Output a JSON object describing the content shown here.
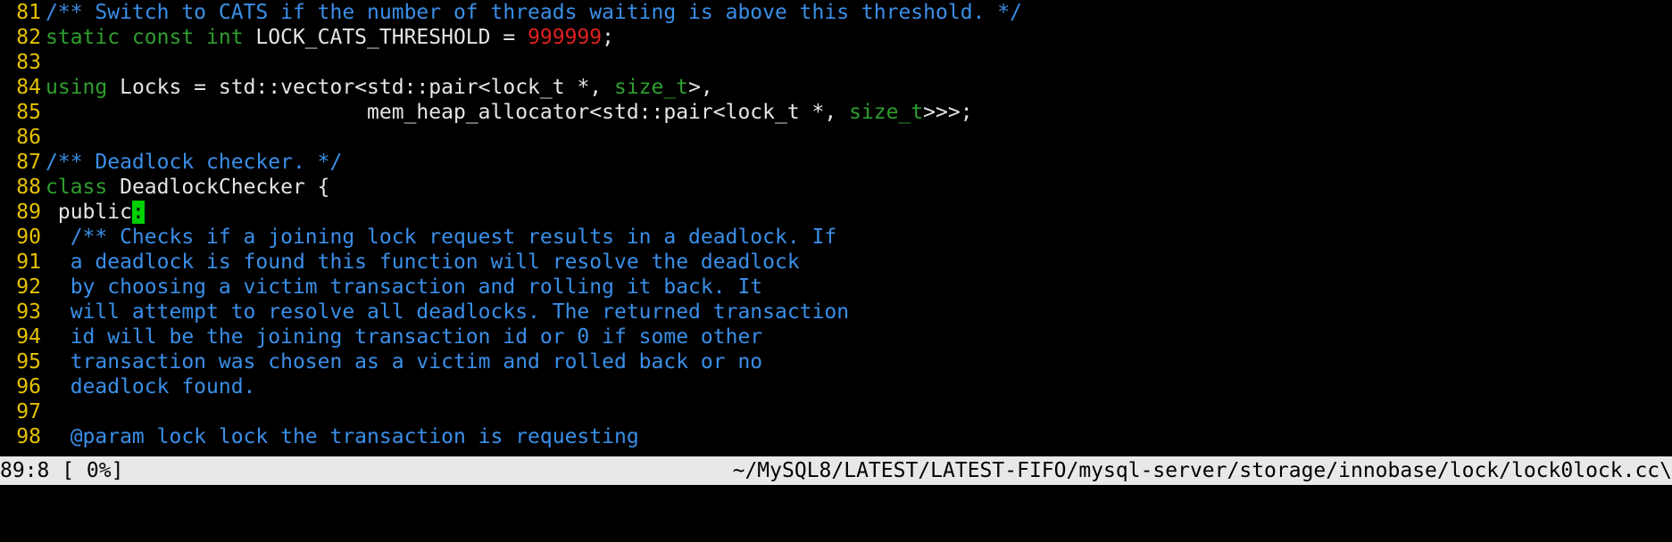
{
  "editor": {
    "colors": {
      "background": "#000000",
      "line_number": "#e6c200",
      "comment": "#3a8fe8",
      "keyword": "#2f9e2f",
      "number": "#e02020",
      "text": "#e5e5e5",
      "cursor": "#00d000",
      "statusbar": "#e8e8e8"
    },
    "lines": [
      {
        "num": "81",
        "parts": [
          {
            "t": "/** Switch to CATS if the number of threads waiting is above this threshold. */",
            "c": "comment"
          }
        ]
      },
      {
        "num": "82",
        "parts": [
          {
            "t": "static const int",
            "c": "kw"
          },
          {
            "t": " LOCK_CATS_THRESHOLD = ",
            "c": "plain"
          },
          {
            "t": "999999",
            "c": "num"
          },
          {
            "t": ";",
            "c": "plain"
          }
        ]
      },
      {
        "num": "83",
        "parts": []
      },
      {
        "num": "84",
        "parts": [
          {
            "t": "using",
            "c": "kw"
          },
          {
            "t": " Locks = std::vector<std::pair<lock_t *, ",
            "c": "plain"
          },
          {
            "t": "size_t",
            "c": "kw"
          },
          {
            "t": ">,",
            "c": "plain"
          }
        ]
      },
      {
        "num": "85",
        "parts": [
          {
            "t": "                          mem_heap_allocator<std::pair<lock_t *, ",
            "c": "plain"
          },
          {
            "t": "size_t",
            "c": "kw"
          },
          {
            "t": ">>>;",
            "c": "plain"
          }
        ]
      },
      {
        "num": "86",
        "parts": []
      },
      {
        "num": "87",
        "parts": [
          {
            "t": "/** Deadlock checker. */",
            "c": "comment"
          }
        ]
      },
      {
        "num": "88",
        "parts": [
          {
            "t": "class",
            "c": "kw"
          },
          {
            "t": " DeadlockChecker {",
            "c": "plain"
          }
        ]
      },
      {
        "num": "89",
        "parts": [
          {
            "t": " public",
            "c": "plain"
          },
          {
            "t": ":",
            "c": "cursor"
          }
        ]
      },
      {
        "num": "90",
        "parts": [
          {
            "t": "  /** Checks if a joining lock request results in a deadlock. If",
            "c": "comment"
          }
        ]
      },
      {
        "num": "91",
        "parts": [
          {
            "t": "  a deadlock is found this function will resolve the deadlock",
            "c": "comment"
          }
        ]
      },
      {
        "num": "92",
        "parts": [
          {
            "t": "  by choosing a victim transaction and rolling it back. It",
            "c": "comment"
          }
        ]
      },
      {
        "num": "93",
        "parts": [
          {
            "t": "  will attempt to resolve all deadlocks. The returned transaction",
            "c": "comment"
          }
        ]
      },
      {
        "num": "94",
        "parts": [
          {
            "t": "  id will be the joining transaction id or 0 if some other",
            "c": "comment"
          }
        ]
      },
      {
        "num": "95",
        "parts": [
          {
            "t": "  transaction was chosen as a victim and rolled back or no",
            "c": "comment"
          }
        ]
      },
      {
        "num": "96",
        "parts": [
          {
            "t": "  deadlock found.",
            "c": "comment"
          }
        ]
      },
      {
        "num": "97",
        "parts": []
      },
      {
        "num": "98",
        "parts": [
          {
            "t": "  @param lock lock the transaction is requesting",
            "c": "comment"
          }
        ]
      }
    ]
  },
  "statusbar": {
    "position": "89:8 [ 0%]",
    "file_path": "~/MySQL8/LATEST/LATEST-FIFO/mysql-server/storage/innobase/lock/lock0lock.cc\\"
  }
}
